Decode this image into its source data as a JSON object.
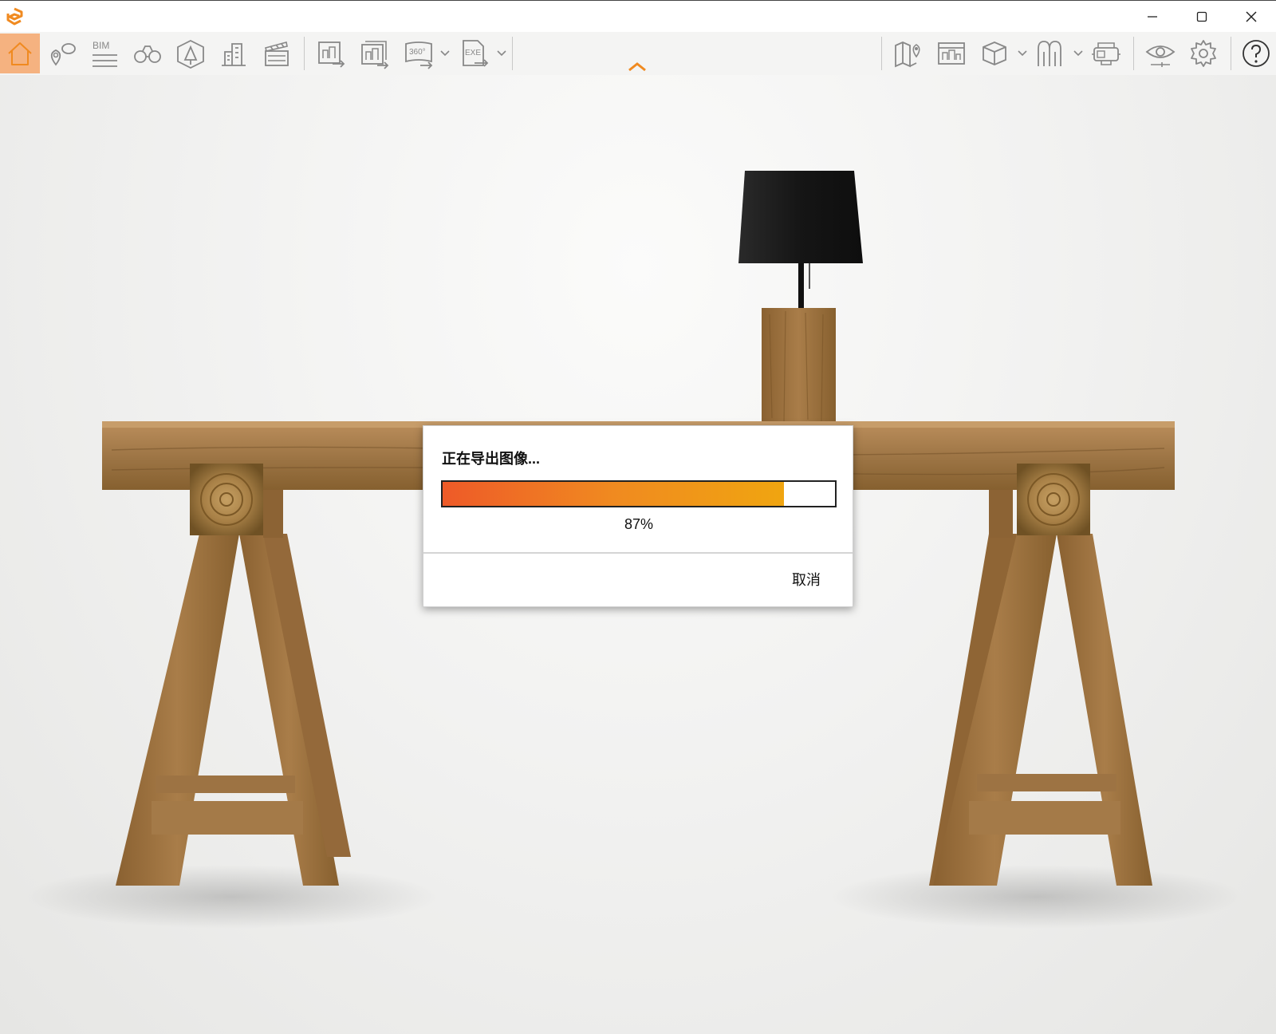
{
  "window": {
    "controls": [
      "minimize",
      "maximize",
      "close"
    ]
  },
  "toolbar": {
    "accent": "#f08a20",
    "left_tools": [
      {
        "name": "home-icon",
        "active": true
      },
      {
        "name": "location-pin-icon"
      },
      {
        "name": "bim-icon",
        "label": "BIM"
      },
      {
        "name": "binoculars-icon"
      },
      {
        "name": "perspective-icon"
      },
      {
        "name": "buildings-icon"
      },
      {
        "name": "clapperboard-icon"
      },
      {
        "name": "export-image-icon"
      },
      {
        "name": "batch-export-icon"
      },
      {
        "name": "export-360-icon",
        "label": "360°"
      },
      {
        "name": "export-exe-icon",
        "label": "EXE"
      }
    ],
    "right_tools": [
      {
        "name": "map-icon"
      },
      {
        "name": "web-export-icon"
      },
      {
        "name": "cube-icon"
      },
      {
        "name": "asset-library-icon"
      },
      {
        "name": "vr-headset-icon"
      },
      {
        "name": "eye-icon"
      },
      {
        "name": "settings-icon"
      },
      {
        "name": "help-icon"
      }
    ]
  },
  "dialog": {
    "title": "正在导出图像...",
    "progress_value": 0.87,
    "progress_text": "87%",
    "cancel_label": "取消",
    "progress_colors": [
      "#ee5a28",
      "#f0a510"
    ]
  },
  "toolbar_labels": {
    "bim": "BIM",
    "three_sixty": "360°",
    "exe": "EXE"
  }
}
